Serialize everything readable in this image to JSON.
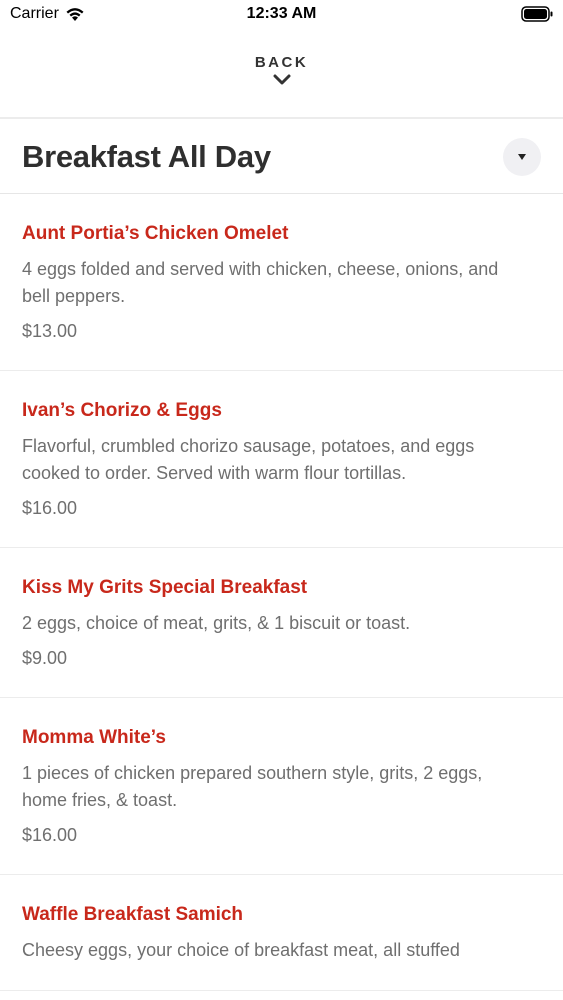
{
  "status_bar": {
    "carrier": "Carrier",
    "time": "12:33 AM"
  },
  "nav": {
    "back_label": "BACK"
  },
  "section": {
    "title": "Breakfast All Day"
  },
  "colors": {
    "item_name": "#c8281b",
    "text_muted": "#6f6f6f",
    "title": "#2f2f2f"
  },
  "items": [
    {
      "name": "Aunt Portia’s Chicken Omelet",
      "description": "4 eggs folded and served with chicken, cheese, onions, and bell peppers.",
      "price": "$13.00"
    },
    {
      "name": "Ivan’s Chorizo & Eggs",
      "description": "Flavorful, crumbled chorizo sausage, potatoes, and eggs cooked to order. Served with warm flour tortillas.",
      "price": "$16.00"
    },
    {
      "name": "Kiss My Grits Special Breakfast",
      "description": "2 eggs, choice of meat, grits, & 1 biscuit or toast.",
      "price": "$9.00"
    },
    {
      "name": "Momma White’s",
      "description": "1 pieces of chicken prepared southern style, grits, 2 eggs, home fries, & toast.",
      "price": "$16.00"
    },
    {
      "name": "Waffle Breakfast Samich",
      "description": "Cheesy eggs, your choice of breakfast meat, all stuffed",
      "price": ""
    }
  ]
}
